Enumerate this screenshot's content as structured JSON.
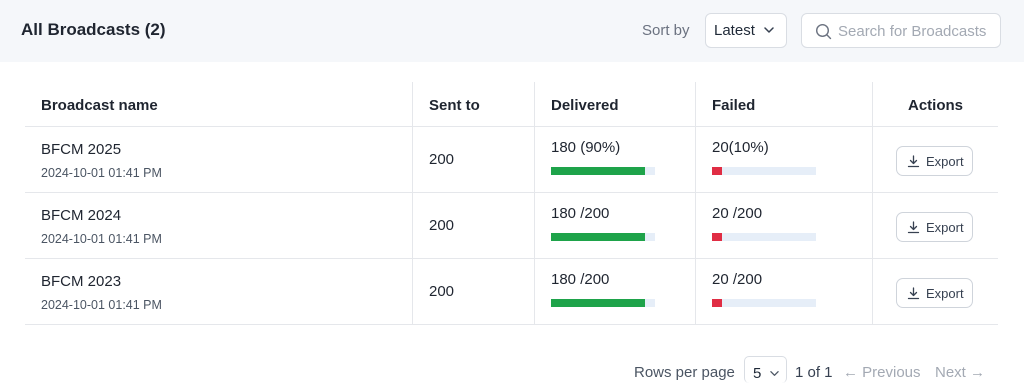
{
  "header": {
    "title": "All Broadcasts (2)",
    "sort_label": "Sort by",
    "sort_value": "Latest",
    "search_placeholder": "Search for Broadcasts"
  },
  "table": {
    "columns": [
      "Broadcast name",
      "Sent to",
      "Delivered",
      "Failed",
      "Actions"
    ],
    "rows": [
      {
        "name": "BFCM 2025",
        "date": "2024-10-01 01:41 PM",
        "sent_to": "200",
        "delivered_text": "180 (90%)",
        "delivered_fraction": 0.9,
        "failed_text": "20(10%)",
        "failed_fraction": 0.1,
        "action": "Export"
      },
      {
        "name": "BFCM 2024",
        "date": "2024-10-01 01:41 PM",
        "sent_to": "200",
        "delivered_text": "180 /200",
        "delivered_fraction": 0.9,
        "failed_text": "20 /200",
        "failed_fraction": 0.1,
        "action": "Export"
      },
      {
        "name": "BFCM 2023",
        "date": "2024-10-01 01:41 PM",
        "sent_to": "200",
        "delivered_text": "180 /200",
        "delivered_fraction": 0.9,
        "failed_text": "20 /200",
        "failed_fraction": 0.1,
        "action": "Export"
      }
    ]
  },
  "pagination": {
    "rows_per_page_label": "Rows per page",
    "rows_per_page_value": "5",
    "page_info": "1 of 1",
    "previous_label": "← Previous",
    "next_label": "Next →"
  },
  "colors": {
    "delivered_bar": "#1ea34a",
    "failed_bar": "#e02d44",
    "bar_track": "#e6eef8",
    "header_bg": "#f5f7fa"
  }
}
